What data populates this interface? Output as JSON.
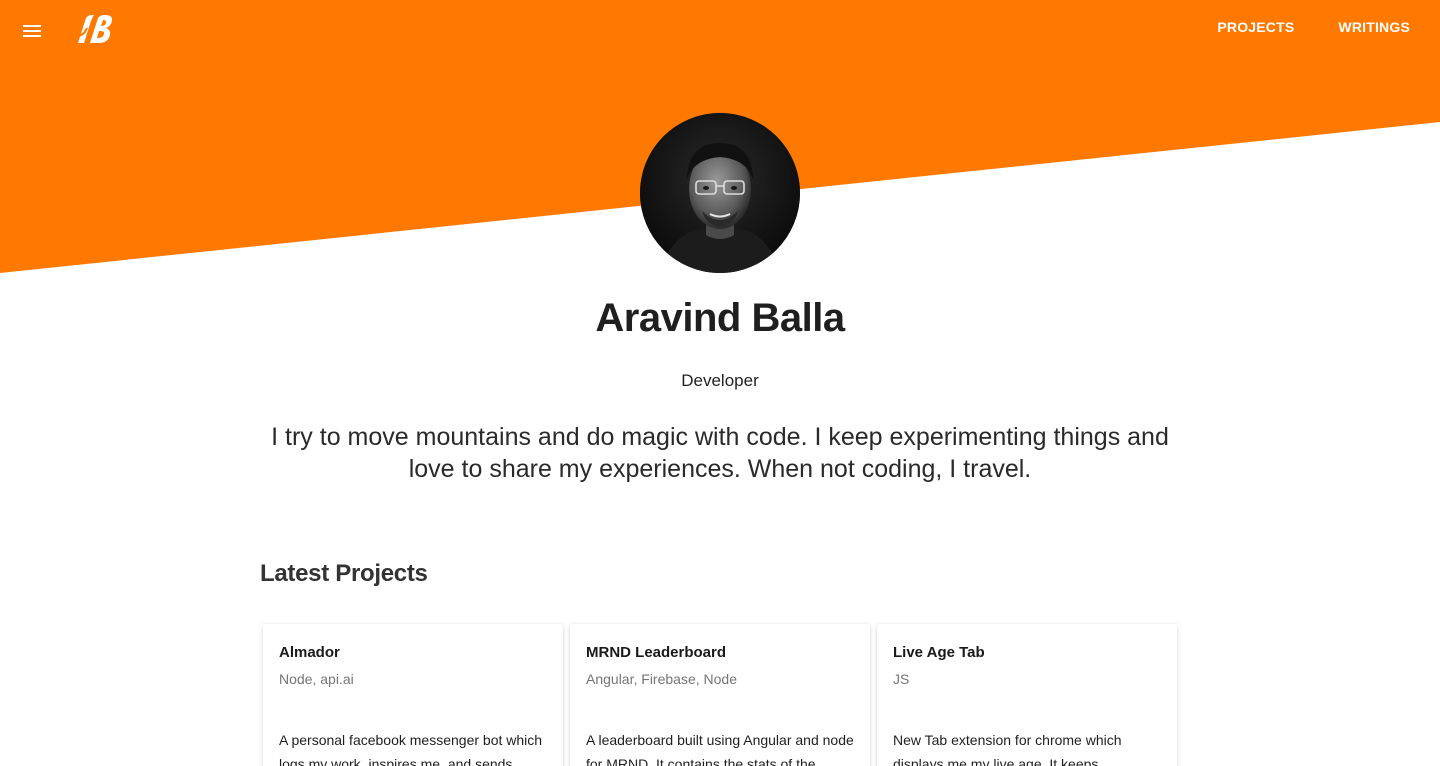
{
  "colors": {
    "accent": "#ff7800",
    "text": "#222222",
    "muted": "#757575"
  },
  "header": {
    "menu_icon": "hamburger-menu-icon",
    "logo_text": "AB",
    "nav": [
      {
        "label": "PROJECTS"
      },
      {
        "label": "WRITINGS"
      }
    ]
  },
  "profile": {
    "name": "Aravind Balla",
    "role": "Developer",
    "bio": "I try to move mountains and do magic with code. I keep experimenting things and love to share my experiences. When not coding, I travel."
  },
  "projects": {
    "title": "Latest Projects",
    "items": [
      {
        "title": "Almador",
        "tags": "Node, api.ai",
        "description": "A personal facebook messenger bot which logs my work, inspires me, and sends"
      },
      {
        "title": "MRND Leaderboard",
        "tags": "Angular, Firebase, Node",
        "description": "A leaderboard built using Angular and node for MRND. It contains the stats of the"
      },
      {
        "title": "Live Age Tab",
        "tags": "JS",
        "description": "New Tab extension for chrome which displays me my live age. It keeps"
      }
    ]
  }
}
